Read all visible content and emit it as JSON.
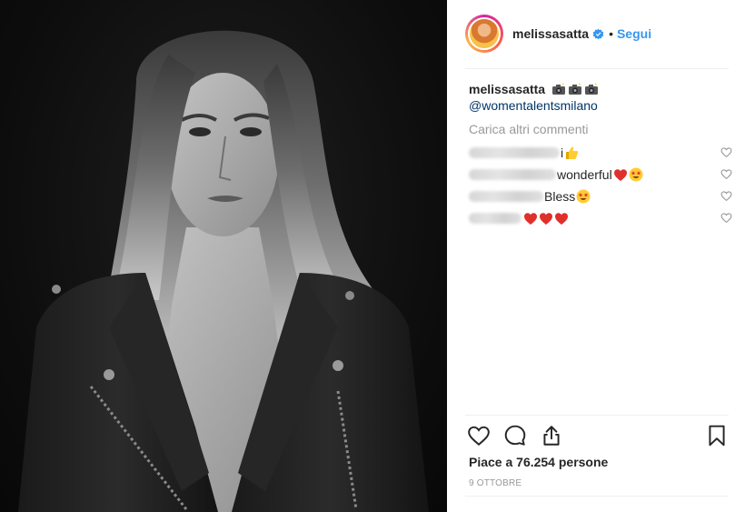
{
  "header": {
    "username": "melissasatta",
    "separator": "•",
    "follow_label": "Segui"
  },
  "caption": {
    "username": "melissasatta",
    "emoji_icons": [
      "camera-with-flash-icon",
      "camera-with-flash-icon",
      "camera-with-flash-icon"
    ],
    "mention": "@womentalentsmilano"
  },
  "load_more": "Carica altri commenti",
  "comments": [
    {
      "username": "[blurred]",
      "text": "i",
      "emoji": [
        "thumbs-up-icon"
      ]
    },
    {
      "username": "_model_team_",
      "text": " wonderful",
      "emoji": [
        "red-heart-icon",
        "star-struck-icon"
      ]
    },
    {
      "username": "[blurred]",
      "text": "Bless",
      "emoji": [
        "star-struck-icon"
      ]
    },
    {
      "username": "[blurred]",
      "text": " ",
      "emoji": [
        "red-heart-icon",
        "red-heart-icon",
        "red-heart-icon"
      ]
    }
  ],
  "likes": "Piace a 76.254 persone",
  "date": "9 OTTOBRE",
  "colors": {
    "link_blue": "#3897f0",
    "mention_blue": "#003569",
    "muted_gray": "#999999",
    "text_dark": "#262626",
    "divider": "#efefef"
  }
}
